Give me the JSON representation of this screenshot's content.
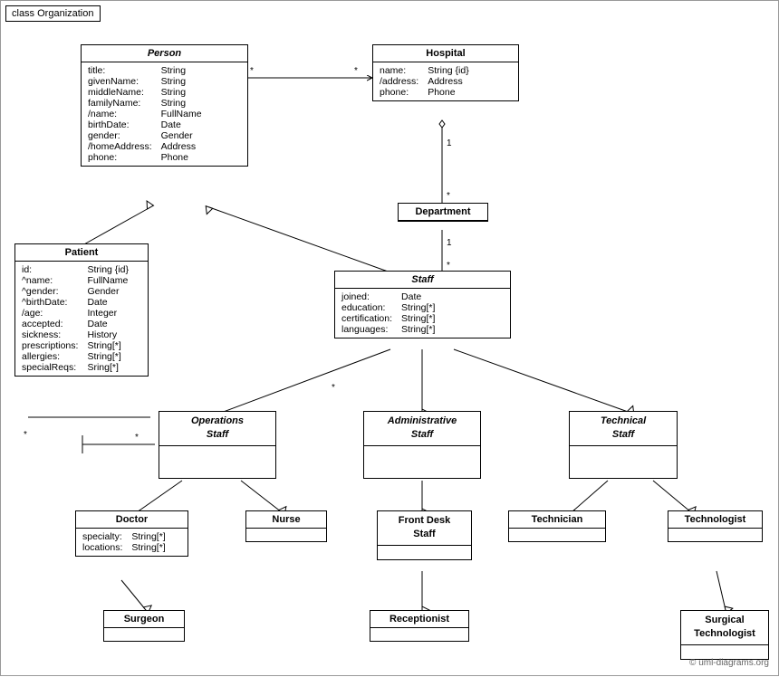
{
  "diagram": {
    "title": "class Organization",
    "classes": {
      "person": {
        "name": "Person",
        "italic": true,
        "attributes": [
          [
            "title:",
            "String"
          ],
          [
            "givenName:",
            "String"
          ],
          [
            "middleName:",
            "String"
          ],
          [
            "familyName:",
            "String"
          ],
          [
            "/name:",
            "FullName"
          ],
          [
            "birthDate:",
            "Date"
          ],
          [
            "gender:",
            "Gender"
          ],
          [
            "/homeAddress:",
            "Address"
          ],
          [
            "phone:",
            "Phone"
          ]
        ]
      },
      "hospital": {
        "name": "Hospital",
        "italic": false,
        "attributes": [
          [
            "name:",
            "String {id}"
          ],
          [
            "/address:",
            "Address"
          ],
          [
            "phone:",
            "Phone"
          ]
        ]
      },
      "patient": {
        "name": "Patient",
        "italic": false,
        "attributes": [
          [
            "id:",
            "String {id}"
          ],
          [
            "^name:",
            "FullName"
          ],
          [
            "^gender:",
            "Gender"
          ],
          [
            "^birthDate:",
            "Date"
          ],
          [
            "/age:",
            "Integer"
          ],
          [
            "accepted:",
            "Date"
          ],
          [
            "sickness:",
            "History"
          ],
          [
            "prescriptions:",
            "String[*]"
          ],
          [
            "allergies:",
            "String[*]"
          ],
          [
            "specialReqs:",
            "Sring[*]"
          ]
        ]
      },
      "department": {
        "name": "Department",
        "italic": false,
        "attributes": []
      },
      "staff": {
        "name": "Staff",
        "italic": true,
        "attributes": [
          [
            "joined:",
            "Date"
          ],
          [
            "education:",
            "String[*]"
          ],
          [
            "certification:",
            "String[*]"
          ],
          [
            "languages:",
            "String[*]"
          ]
        ]
      },
      "operations_staff": {
        "name": "Operations\nStaff",
        "italic": true,
        "attributes": []
      },
      "administrative_staff": {
        "name": "Administrative\nStaff",
        "italic": true,
        "attributes": []
      },
      "technical_staff": {
        "name": "Technical\nStaff",
        "italic": true,
        "attributes": []
      },
      "doctor": {
        "name": "Doctor",
        "italic": false,
        "attributes": [
          [
            "specialty:",
            "String[*]"
          ],
          [
            "locations:",
            "String[*]"
          ]
        ]
      },
      "nurse": {
        "name": "Nurse",
        "italic": false,
        "attributes": []
      },
      "front_desk_staff": {
        "name": "Front Desk\nStaff",
        "italic": false,
        "attributes": []
      },
      "technician": {
        "name": "Technician",
        "italic": false,
        "attributes": []
      },
      "technologist": {
        "name": "Technologist",
        "italic": false,
        "attributes": []
      },
      "surgeon": {
        "name": "Surgeon",
        "italic": false,
        "attributes": []
      },
      "receptionist": {
        "name": "Receptionist",
        "italic": false,
        "attributes": []
      },
      "surgical_technologist": {
        "name": "Surgical\nTechnologist",
        "italic": false,
        "attributes": []
      }
    },
    "watermark": "© uml-diagrams.org"
  }
}
